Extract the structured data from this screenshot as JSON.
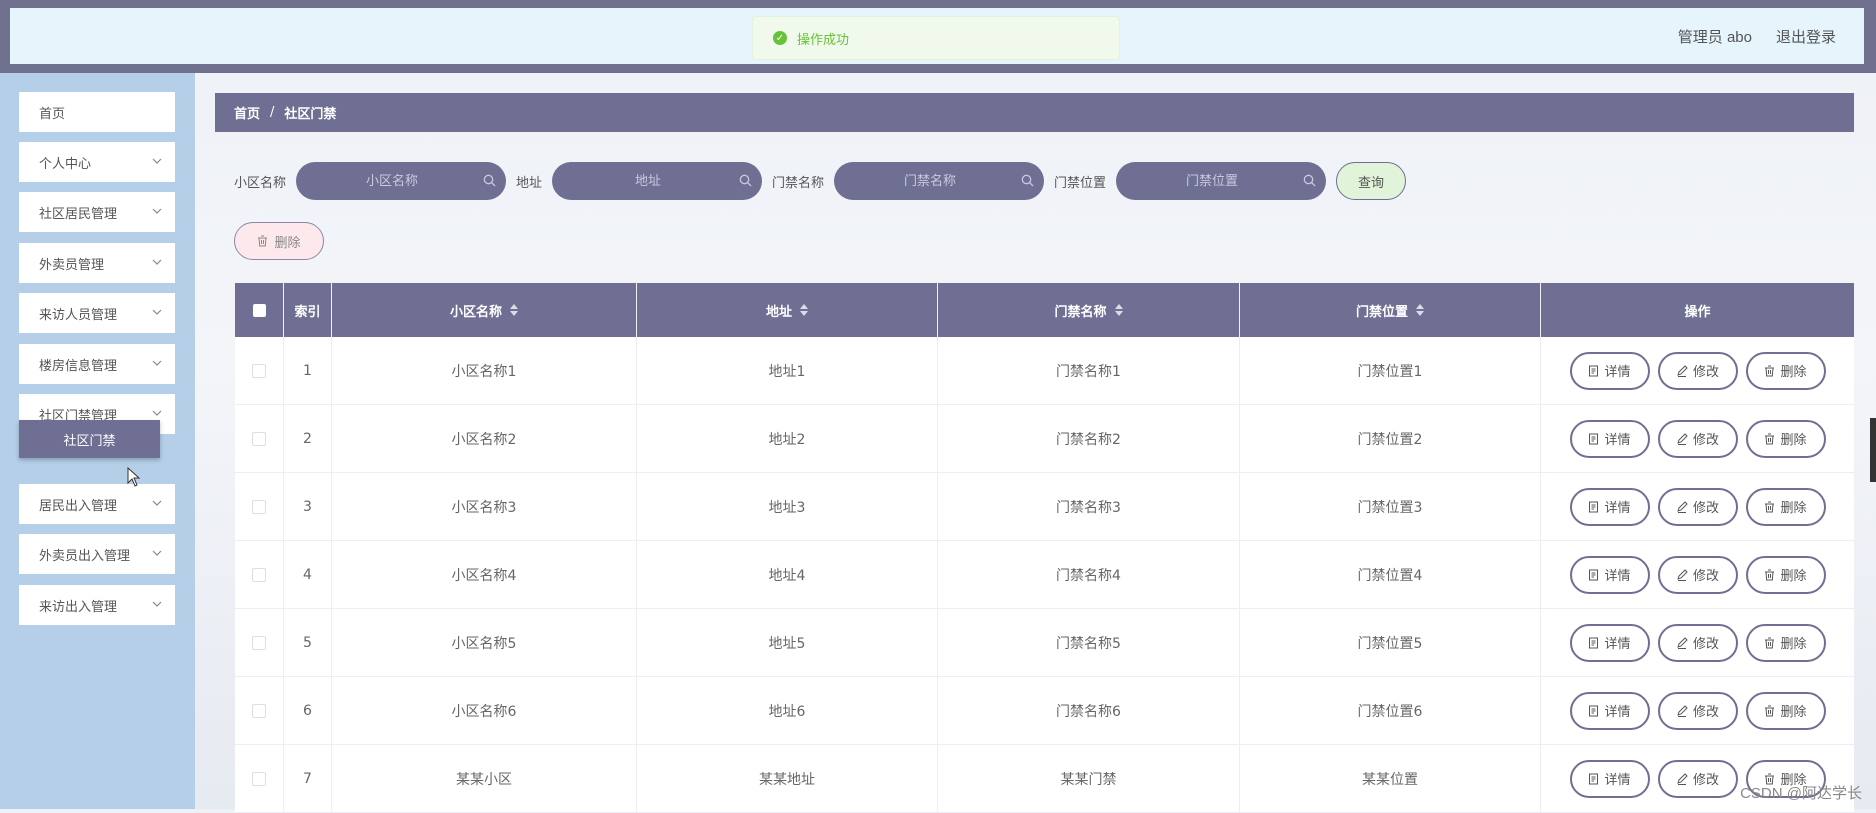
{
  "header": {
    "toast": "操作成功",
    "admin": "管理员 abo",
    "logout": "退出登录"
  },
  "sidebar": {
    "items": [
      {
        "label": "首页",
        "has_chevron": false
      },
      {
        "label": "个人中心",
        "has_chevron": true
      },
      {
        "label": "社区居民管理",
        "has_chevron": true
      },
      {
        "label": "外卖员管理",
        "has_chevron": true
      },
      {
        "label": "来访人员管理",
        "has_chevron": true
      },
      {
        "label": "楼房信息管理",
        "has_chevron": true
      },
      {
        "label": "社区门禁管理",
        "has_chevron": true
      },
      {
        "label": "居民出入管理",
        "has_chevron": true
      },
      {
        "label": "外卖员出入管理",
        "has_chevron": true
      },
      {
        "label": "来访出入管理",
        "has_chevron": true
      }
    ],
    "active_sub": "社区门禁"
  },
  "breadcrumb": {
    "home": "首页",
    "sep": "/",
    "current": "社区门禁"
  },
  "search": {
    "community": {
      "label": "小区名称",
      "placeholder": "小区名称"
    },
    "address": {
      "label": "地址",
      "placeholder": "地址"
    },
    "gate_name": {
      "label": "门禁名称",
      "placeholder": "门禁名称"
    },
    "gate_location": {
      "label": "门禁位置",
      "placeholder": "门禁位置"
    },
    "query_label": "查询"
  },
  "toolbar": {
    "delete_label": "删除"
  },
  "table": {
    "headers": {
      "index": "索引",
      "community": "小区名称",
      "address": "地址",
      "gate_name": "门禁名称",
      "gate_location": "门禁位置",
      "actions": "操作"
    },
    "actions": {
      "detail": "详情",
      "edit": "修改",
      "delete": "删除"
    },
    "rows": [
      {
        "index": "1",
        "community": "小区名称1",
        "address": "地址1",
        "gate_name": "门禁名称1",
        "gate_location": "门禁位置1"
      },
      {
        "index": "2",
        "community": "小区名称2",
        "address": "地址2",
        "gate_name": "门禁名称2",
        "gate_location": "门禁位置2"
      },
      {
        "index": "3",
        "community": "小区名称3",
        "address": "地址3",
        "gate_name": "门禁名称3",
        "gate_location": "门禁位置3"
      },
      {
        "index": "4",
        "community": "小区名称4",
        "address": "地址4",
        "gate_name": "门禁名称4",
        "gate_location": "门禁位置4"
      },
      {
        "index": "5",
        "community": "小区名称5",
        "address": "地址5",
        "gate_name": "门禁名称5",
        "gate_location": "门禁位置5"
      },
      {
        "index": "6",
        "community": "小区名称6",
        "address": "地址6",
        "gate_name": "门禁名称6",
        "gate_location": "门禁位置6"
      },
      {
        "index": "7",
        "community": "某某小区",
        "address": "某某地址",
        "gate_name": "某某门禁",
        "gate_location": "某某位置"
      }
    ]
  },
  "watermark": "CSDN @阿达学长",
  "colors": {
    "primary": "#6e6f93",
    "sidebar_bg": "#b5cfe9",
    "topbar_bg": "#e6f4fc",
    "success": "#67c23a",
    "success_bg": "#f0f9eb"
  }
}
